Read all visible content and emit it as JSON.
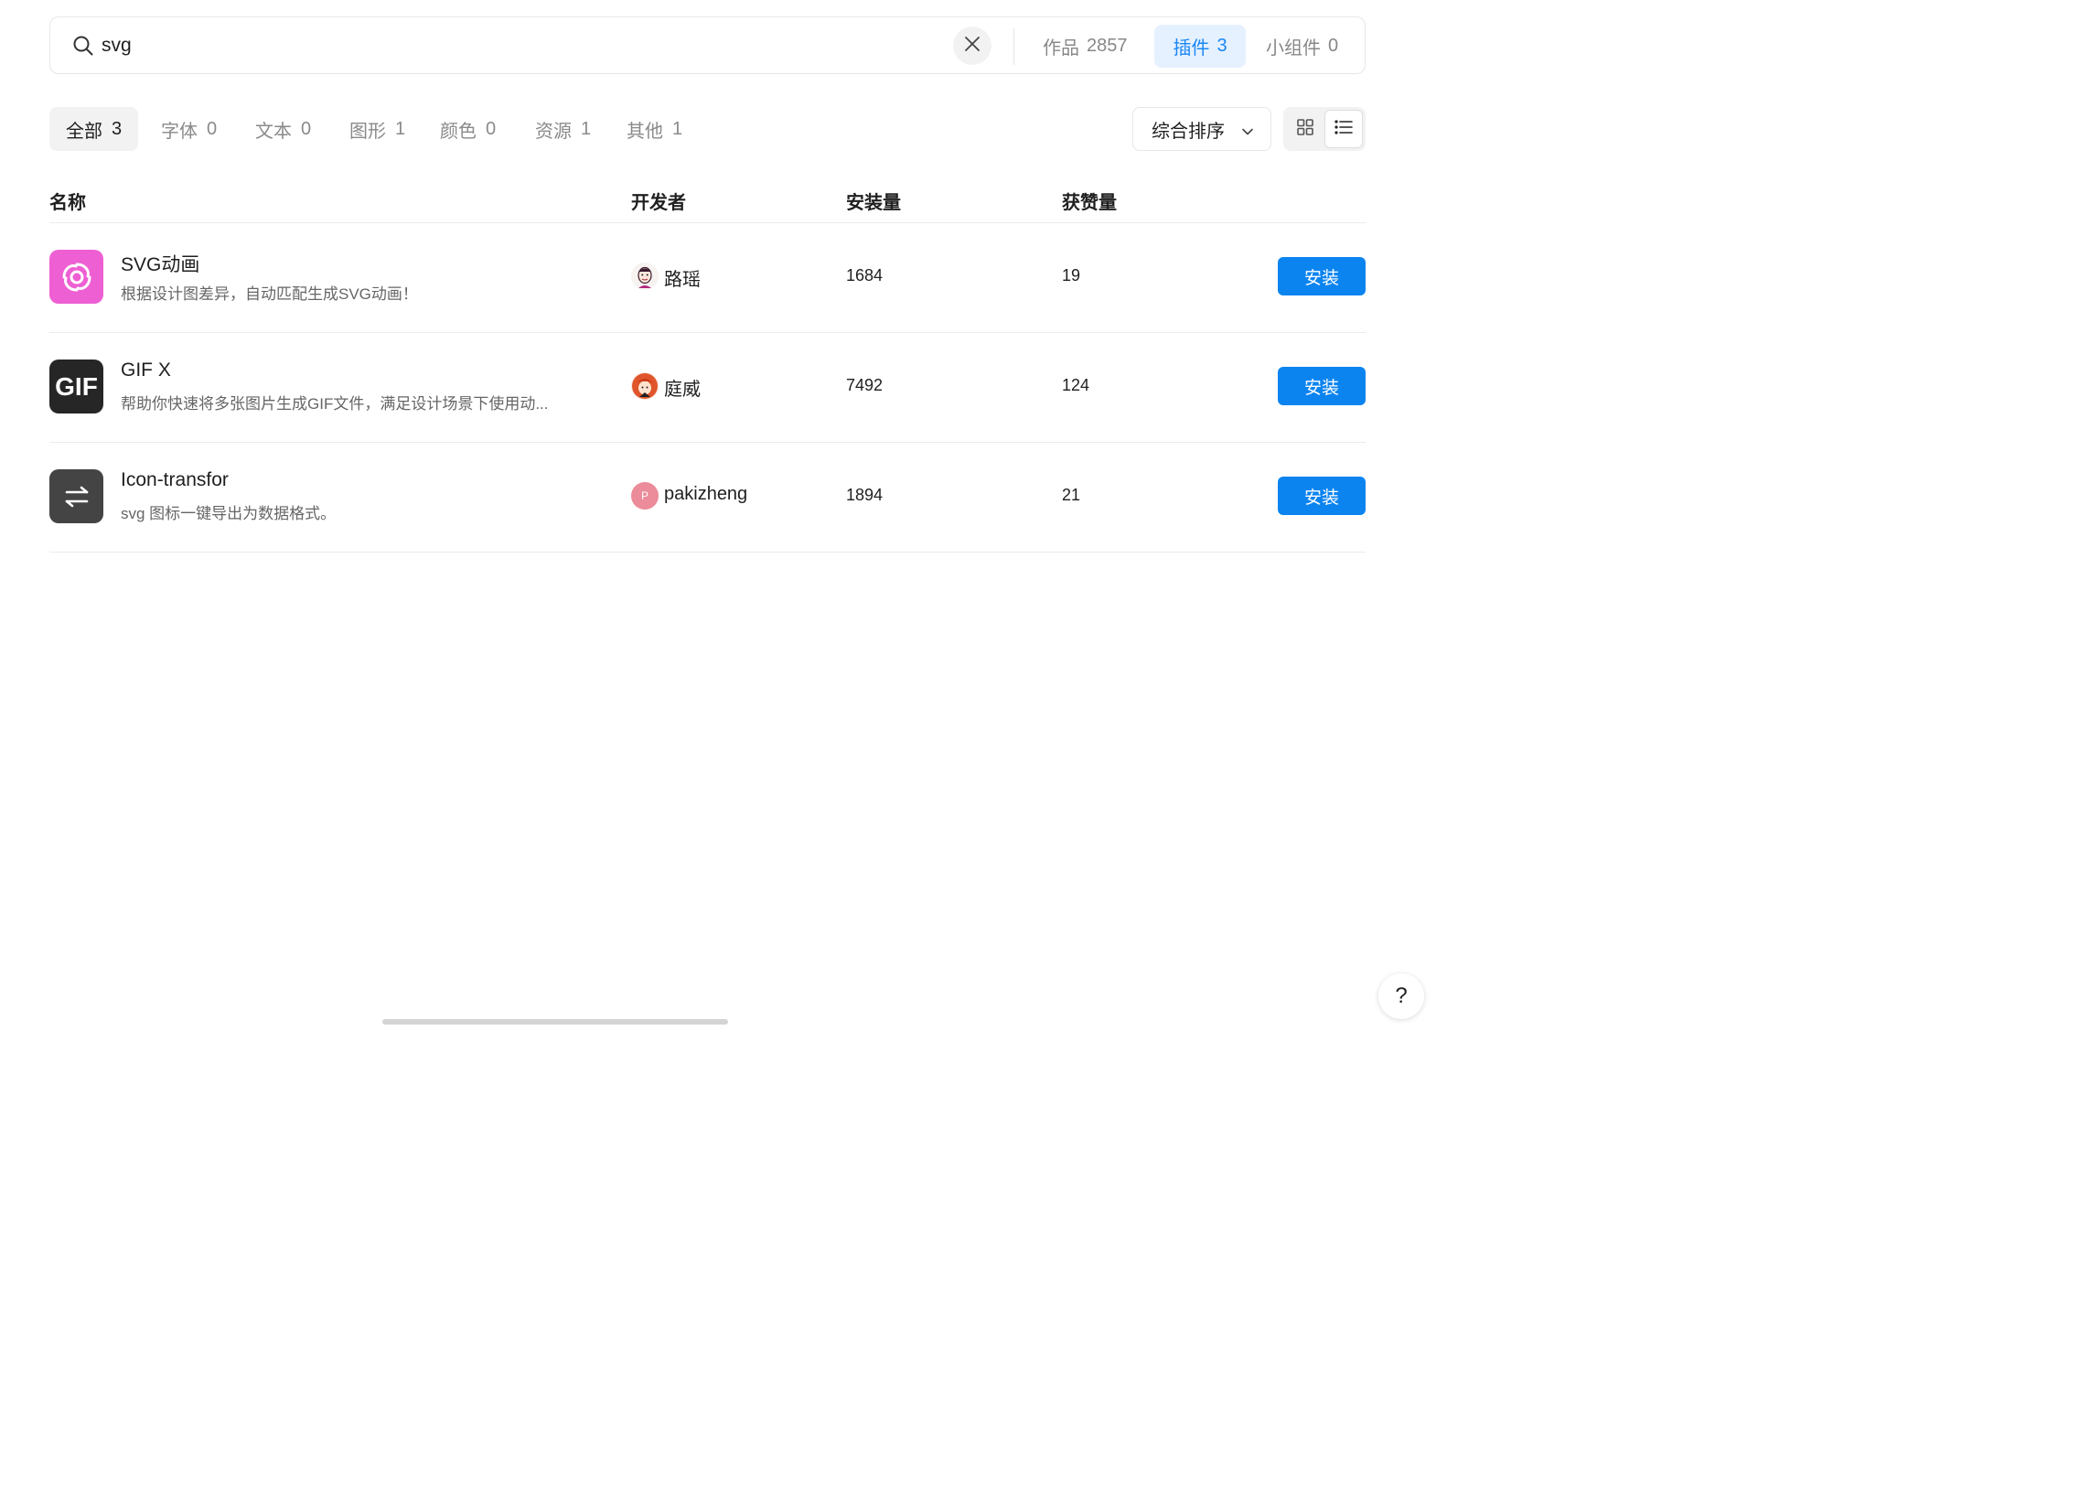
{
  "search": {
    "value": "svg"
  },
  "scope_tabs": [
    {
      "label": "作品",
      "count": "2857"
    },
    {
      "label": "插件",
      "count": "3"
    },
    {
      "label": "小组件",
      "count": "0"
    }
  ],
  "categories": [
    {
      "label": "全部",
      "count": "3"
    },
    {
      "label": "字体",
      "count": "0"
    },
    {
      "label": "文本",
      "count": "0"
    },
    {
      "label": "图形",
      "count": "1"
    },
    {
      "label": "颜色",
      "count": "0"
    },
    {
      "label": "资源",
      "count": "1"
    },
    {
      "label": "其他",
      "count": "1"
    }
  ],
  "sort": {
    "label": "综合排序"
  },
  "table": {
    "headers": {
      "name": "名称",
      "developer": "开发者",
      "installs": "安装量",
      "likes": "获赞量"
    },
    "rows": [
      {
        "name": "SVG动画",
        "desc": "根据设计图差异，自动匹配生成SVG动画！",
        "developer": "路瑶",
        "installs": "1684",
        "likes": "19",
        "action": "安装",
        "icon": "swirl-icon",
        "icon_color": "#ee5fd3"
      },
      {
        "name": "GIF X",
        "desc": "帮助你快速将多张图片生成GIF文件，满足设计场景下使用动...",
        "developer": "庭威",
        "installs": "7492",
        "likes": "124",
        "action": "安装",
        "icon": "gif-icon",
        "icon_text": "GIF",
        "icon_color": "#262626"
      },
      {
        "name": "Icon-transfor",
        "desc": "svg 图标一键导出为数据格式。",
        "developer": "pakizheng",
        "installs": "1894",
        "likes": "21",
        "action": "安装",
        "icon": "swap-arrows-icon",
        "icon_color": "#444444",
        "avatar_letter": "P"
      }
    ]
  },
  "help": {
    "label": "?"
  },
  "colors": {
    "accent": "#0b84f0",
    "active_tab_bg": "#e5f1ff",
    "active_tab_text": "#1a86f5"
  }
}
